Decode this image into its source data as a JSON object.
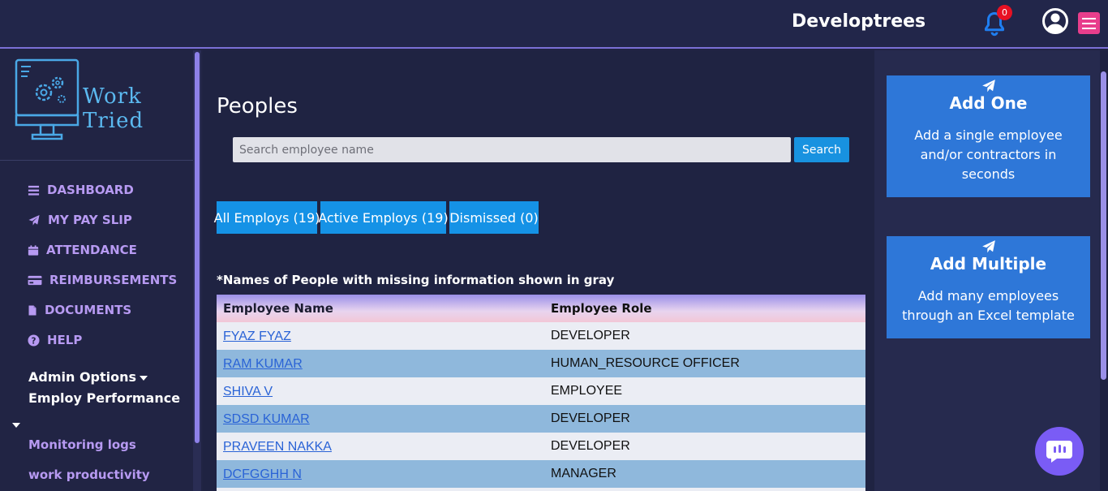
{
  "header": {
    "brand": "Developtrees",
    "notification_count": "0"
  },
  "sidebar": {
    "logo_text": "Work Tried",
    "items": [
      {
        "label": "DASHBOARD",
        "icon": "bars-icon"
      },
      {
        "label": "MY PAY SLIP",
        "icon": "paper-plane-icon"
      },
      {
        "label": "ATTENDANCE",
        "icon": "calendar-icon"
      },
      {
        "label": "REIMBURSEMENTS",
        "icon": "credit-card-icon"
      },
      {
        "label": "DOCUMENTS",
        "icon": "file-icon"
      },
      {
        "label": "HELP",
        "icon": "question-circle-icon"
      }
    ],
    "admin_options": "Admin Options",
    "employ_performance": "Employ Performance",
    "sub_items": [
      "Monitoring logs",
      "work productivity"
    ]
  },
  "main": {
    "title": "Peoples",
    "search": {
      "placeholder": "Search employee name",
      "button": "Search"
    },
    "filters": [
      "All Employs (19)",
      "Active Employs (19)",
      "Dismissed (0)"
    ],
    "note": "*Names of People with missing information shown in gray",
    "table": {
      "headers": [
        "Employee Name",
        "Employee Role"
      ],
      "rows": [
        {
          "name": "FYAZ FYAZ",
          "role": "DEVELOPER"
        },
        {
          "name": "RAM KUMAR",
          "role": "HUMAN_RESOURCE OFFICER"
        },
        {
          "name": "SHIVA V",
          "role": "EMPLOYEE"
        },
        {
          "name": "SDSD KUMAR",
          "role": "DEVELOPER"
        },
        {
          "name": "PRAVEEN NAKKA",
          "role": "DEVELOPER"
        },
        {
          "name": "DCFGGHH N",
          "role": "MANAGER"
        }
      ]
    }
  },
  "right_panel": {
    "add_one": {
      "title": "Add One",
      "desc": "Add a single employee and/or contractors in seconds"
    },
    "add_multiple": {
      "title": "Add Multiple",
      "desc": "Add many employees through an Excel template"
    }
  },
  "colors": {
    "background": "#212444",
    "accent_purple": "#b79af2",
    "button_blue": "#1592e6",
    "card_blue": "#2e77d8",
    "badge_red": "#e81123",
    "menu_pink": "#e83e8c"
  }
}
